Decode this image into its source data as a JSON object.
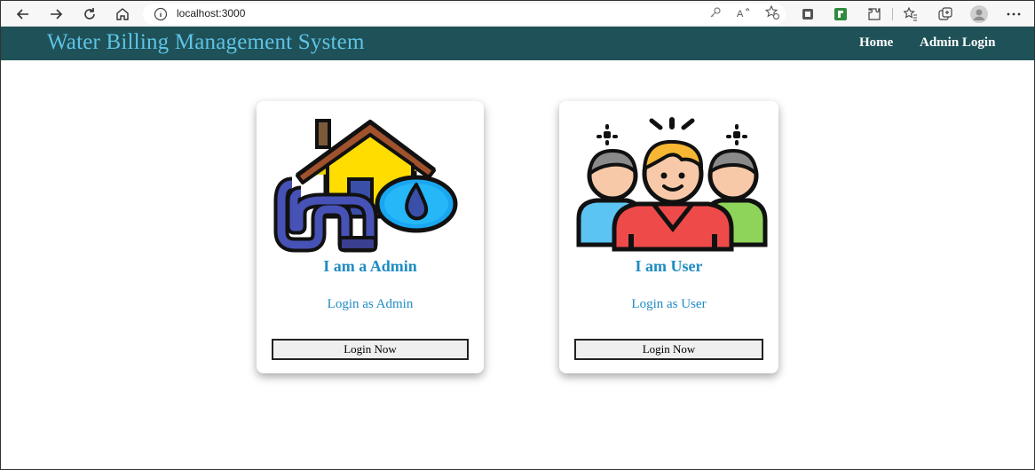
{
  "browser": {
    "url": "localhost:3000"
  },
  "header": {
    "brand": "Water Billing Management System",
    "nav": [
      {
        "label": "Home"
      },
      {
        "label": "Admin Login"
      }
    ]
  },
  "cards": [
    {
      "title": "I am a Admin",
      "subtitle": "Login as Admin",
      "button": "Login Now",
      "icon": "house-water-icon"
    },
    {
      "title": "I am User",
      "subtitle": "Login as User",
      "button": "Login Now",
      "icon": "user-group-icon"
    }
  ],
  "colors": {
    "navbar": "#1f5158",
    "brand": "#5ec4e6",
    "accent": "#1e8bc3"
  }
}
